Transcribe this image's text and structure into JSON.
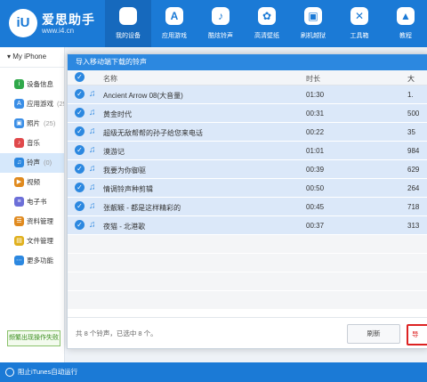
{
  "app": {
    "brand_name": "爱思助手",
    "brand_url": "www.i4.cn",
    "logo_text": "iU"
  },
  "nav": [
    {
      "label": "我的设备",
      "icon": "apple-icon",
      "glyph": ""
    },
    {
      "label": "应用游戏",
      "icon": "app-store-icon",
      "glyph": "A"
    },
    {
      "label": "酷炫铃声",
      "icon": "bell-icon",
      "glyph": "♪"
    },
    {
      "label": "高清壁纸",
      "icon": "flower-icon",
      "glyph": "✿"
    },
    {
      "label": "刷机越狱",
      "icon": "box-icon",
      "glyph": "▣"
    },
    {
      "label": "工具箱",
      "icon": "tools-icon",
      "glyph": "✕"
    },
    {
      "label": "教程",
      "icon": "graduation-icon",
      "glyph": "▲"
    }
  ],
  "sidebar": {
    "device_label": "My iPhone",
    "items": [
      {
        "label": "设备信息",
        "count": "",
        "icon": "info-icon",
        "color": "#2fa84a",
        "glyph": "i"
      },
      {
        "label": "应用游戏",
        "count": "(25)",
        "icon": "apps-icon",
        "color": "#3a8ee6",
        "glyph": "A"
      },
      {
        "label": "照片",
        "count": "(25)",
        "icon": "photo-icon",
        "color": "#3a8ee6",
        "glyph": "▣"
      },
      {
        "label": "音乐",
        "count": "",
        "icon": "music-icon",
        "color": "#e0494b",
        "glyph": "♪"
      },
      {
        "label": "铃声",
        "count": "(0)",
        "icon": "ringtone-icon",
        "color": "#2c88e0",
        "glyph": "♫"
      },
      {
        "label": "视频",
        "count": "",
        "icon": "video-icon",
        "color": "#e08a1e",
        "glyph": "▶"
      },
      {
        "label": "电子书",
        "count": "",
        "icon": "ebook-icon",
        "color": "#6c6fd8",
        "glyph": "≡"
      },
      {
        "label": "资料管理",
        "count": "",
        "icon": "contacts-icon",
        "color": "#e08a1e",
        "glyph": "☰"
      },
      {
        "label": "文件管理",
        "count": "",
        "icon": "folder-icon",
        "color": "#e0b01e",
        "glyph": "▤"
      },
      {
        "label": "更多功能",
        "count": "",
        "icon": "more-icon",
        "color": "#2c88e0",
        "glyph": "⋯"
      }
    ],
    "feedback_label": "频繁出现操作失败"
  },
  "statusbar": {
    "text": "阻止iTunes自动运行"
  },
  "dialog": {
    "title": "导入移动端下载的铃声",
    "columns": {
      "name": "名称",
      "duration": "时长",
      "size": "大"
    },
    "rows": [
      {
        "name": "Ancient Arrow 08(大音量)",
        "duration": "01:30",
        "size": "1."
      },
      {
        "name": "黄金时代",
        "duration": "00:31",
        "size": "500"
      },
      {
        "name": "超级无敌帮帮的孙子给您来电话",
        "duration": "00:22",
        "size": "35"
      },
      {
        "name": "漠游记",
        "duration": "01:01",
        "size": "984"
      },
      {
        "name": "我要为你御驱",
        "duration": "00:39",
        "size": "629"
      },
      {
        "name": "情调铃声种剪辑",
        "duration": "00:50",
        "size": "264"
      },
      {
        "name": "张靓颖 - 都是这样精彩的",
        "duration": "00:45",
        "size": "718"
      },
      {
        "name": "夜猫 - 北港歌",
        "duration": "00:37",
        "size": "313"
      }
    ],
    "summary": "共 8 个铃声，已选中 8 个。",
    "cancel_label": "刷新",
    "confirm_label": "导"
  }
}
